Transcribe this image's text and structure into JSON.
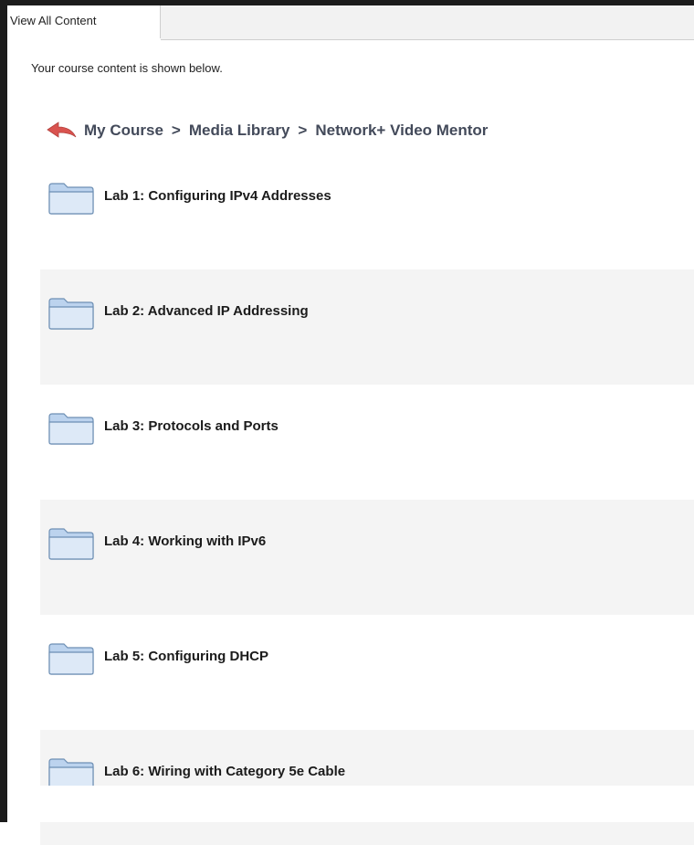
{
  "tabs": [
    {
      "label": "View All Content",
      "active": true
    }
  ],
  "intro_text": "Your course content is shown below.",
  "breadcrumb": {
    "back_icon": "back-arrow-icon",
    "items": [
      "My Course",
      "Media Library",
      "Network+ Video Mentor"
    ],
    "separator": ">"
  },
  "items": [
    {
      "label": "Lab 1: Configuring IPv4 Addresses",
      "icon": "folder-icon"
    },
    {
      "label": "Lab 2: Advanced IP Addressing",
      "icon": "folder-icon"
    },
    {
      "label": "Lab 3: Protocols and Ports",
      "icon": "folder-icon"
    },
    {
      "label": "Lab 4: Working with IPv6",
      "icon": "folder-icon"
    },
    {
      "label": "Lab 5: Configuring DHCP",
      "icon": "folder-icon"
    },
    {
      "label": "Lab 6: Wiring with Category 5e Cable",
      "icon": "folder-icon"
    }
  ],
  "colors": {
    "row_alt_bg": "#f4f4f4",
    "breadcrumb_text": "#434a5a",
    "back_arrow": "#d9534f",
    "folder_fill": "#cfe0f3",
    "folder_stroke": "#6d8fb4"
  }
}
